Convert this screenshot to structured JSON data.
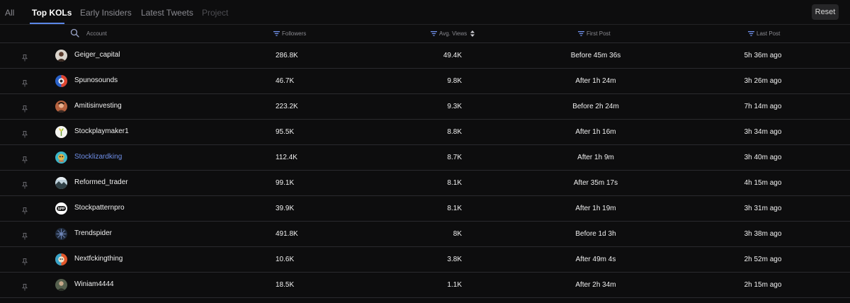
{
  "tabs": [
    {
      "label": "All",
      "state": "normal"
    },
    {
      "label": "Top KOLs",
      "state": "active"
    },
    {
      "label": "Early Insiders",
      "state": "normal"
    },
    {
      "label": "Latest Tweets",
      "state": "normal"
    },
    {
      "label": "Project",
      "state": "disabled"
    }
  ],
  "reset_label": "Reset",
  "columns": {
    "account": "Account",
    "followers": "Followers",
    "avg_views": "Avg. Views",
    "first_post": "First Post",
    "last_post": "Last Post"
  },
  "colors": {
    "accent": "#5b87e8",
    "link": "#6f8fe8",
    "background": "#0d0d0e"
  },
  "rows": [
    {
      "account": "Geiger_capital",
      "followers": "286.8K",
      "avg_views": "49.4K",
      "first_post": "Before 45m 36s",
      "last_post": "5h 36m ago",
      "avatar": "avatar-geiger",
      "highlight": false
    },
    {
      "account": "Spunosounds",
      "followers": "46.7K",
      "avg_views": "9.8K",
      "first_post": "After 1h 24m",
      "last_post": "3h 26m ago",
      "avatar": "avatar-spuno",
      "highlight": false
    },
    {
      "account": "Amitisinvesting",
      "followers": "223.2K",
      "avg_views": "9.3K",
      "first_post": "Before 2h 24m",
      "last_post": "7h 14m ago",
      "avatar": "avatar-amitis",
      "highlight": false
    },
    {
      "account": "Stockplaymaker1",
      "followers": "95.5K",
      "avg_views": "8.8K",
      "first_post": "After 1h 16m",
      "last_post": "3h 34m ago",
      "avatar": "avatar-playmaker",
      "highlight": false
    },
    {
      "account": "Stocklizardking",
      "followers": "112.4K",
      "avg_views": "8.7K",
      "first_post": "After 1h 9m",
      "last_post": "3h 40m ago",
      "avatar": "avatar-lizard",
      "highlight": true
    },
    {
      "account": "Reformed_trader",
      "followers": "99.1K",
      "avg_views": "8.1K",
      "first_post": "After 35m 17s",
      "last_post": "4h 15m ago",
      "avatar": "avatar-reformed",
      "highlight": false
    },
    {
      "account": "Stockpatternpro",
      "followers": "39.9K",
      "avg_views": "8.1K",
      "first_post": "After 1h 19m",
      "last_post": "3h 31m ago",
      "avatar": "avatar-spp",
      "highlight": false
    },
    {
      "account": "Trendspider",
      "followers": "491.8K",
      "avg_views": "8K",
      "first_post": "Before 1d 3h",
      "last_post": "3h 38m ago",
      "avatar": "avatar-trendspider",
      "highlight": false
    },
    {
      "account": "Nextfckingthing",
      "followers": "10.6K",
      "avg_views": "3.8K",
      "first_post": "After 49m 4s",
      "last_post": "2h 52m ago",
      "avatar": "avatar-nextf",
      "highlight": false
    },
    {
      "account": "Winiam4444",
      "followers": "18.5K",
      "avg_views": "1.1K",
      "first_post": "After 2h 34m",
      "last_post": "2h 15m ago",
      "avatar": "avatar-winiam",
      "highlight": false
    }
  ]
}
